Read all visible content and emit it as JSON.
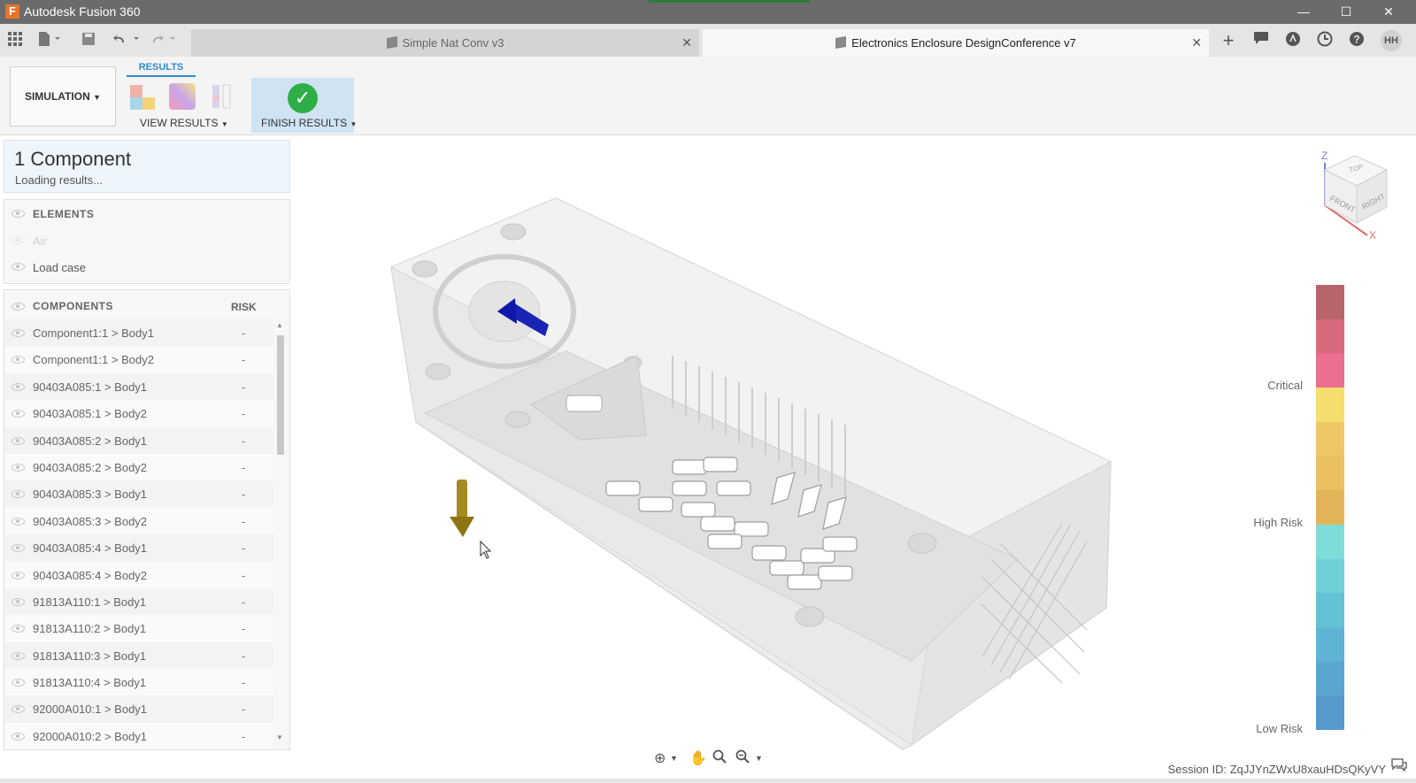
{
  "window": {
    "logo_letter": "F",
    "title": "Autodesk Fusion 360",
    "controls": {
      "minimize": "—",
      "maximize": "☐",
      "close": "✕"
    }
  },
  "tabs": [
    {
      "label": "Simple Nat Conv v3",
      "active": false,
      "close": "✕"
    },
    {
      "label": "Electronics Enclosure DesignConference v7",
      "active": true,
      "close": "✕"
    }
  ],
  "toolbar": {
    "new_tab": "+",
    "user_initials": "HH"
  },
  "ribbon": {
    "workspace": "SIMULATION",
    "results_tab": "RESULTS",
    "view_results": "VIEW RESULTS",
    "finish_results": "FINISH RESULTS"
  },
  "browser": {
    "header_title": "1 Component",
    "header_status": "Loading results...",
    "elements_title": "ELEMENTS",
    "elements": [
      {
        "label": "Air",
        "dim": true
      },
      {
        "label": "Load case",
        "dim": false
      }
    ],
    "components_title": "COMPONENTS",
    "risk_title": "RISK",
    "components": [
      {
        "name": "Component1:1 > Body1",
        "risk": "-"
      },
      {
        "name": "Component1:1 > Body2",
        "risk": "-"
      },
      {
        "name": "90403A085:1 > Body1",
        "risk": "-"
      },
      {
        "name": "90403A085:1 > Body2",
        "risk": "-"
      },
      {
        "name": "90403A085:2 > Body1",
        "risk": "-"
      },
      {
        "name": "90403A085:2 > Body2",
        "risk": "-"
      },
      {
        "name": "90403A085:3 > Body1",
        "risk": "-"
      },
      {
        "name": "90403A085:3 > Body2",
        "risk": "-"
      },
      {
        "name": "90403A085:4 > Body1",
        "risk": "-"
      },
      {
        "name": "90403A085:4 > Body2",
        "risk": "-"
      },
      {
        "name": "91813A110:1 > Body1",
        "risk": "-"
      },
      {
        "name": "91813A110:2 > Body1",
        "risk": "-"
      },
      {
        "name": "91813A110:3 > Body1",
        "risk": "-"
      },
      {
        "name": "91813A110:4 > Body1",
        "risk": "-"
      },
      {
        "name": "92000A010:1 > Body1",
        "risk": "-"
      },
      {
        "name": "92000A010:2 > Body1",
        "risk": "-"
      }
    ]
  },
  "viewcube": {
    "axis_z": "Z",
    "axis_x": "X",
    "face_top": "TOP",
    "face_front": "FRONT",
    "face_right": "RIGHT"
  },
  "legend": {
    "critical": "Critical",
    "high_risk": "High Risk",
    "low_risk": "Low Risk",
    "colors": [
      "#b8646b",
      "#d8697c",
      "#ea6f90",
      "#f6de6e",
      "#efc766",
      "#eac061",
      "#e3b55a",
      "#7fdcd8",
      "#6fcfd6",
      "#64c2d5",
      "#5fb4d3",
      "#5aa6d0",
      "#5699cc"
    ]
  },
  "status": {
    "session": "Session ID: ZqJJYnZWxU8xauHDsQKyVY"
  }
}
